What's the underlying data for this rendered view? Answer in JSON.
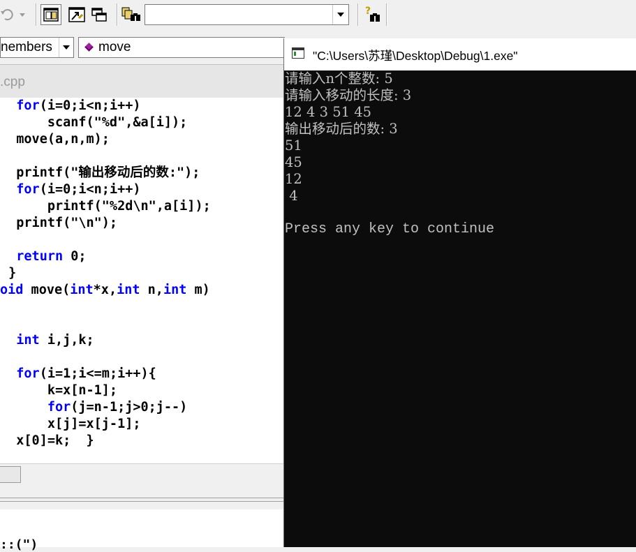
{
  "toolbar": {
    "find_value": "",
    "icons": [
      "undo-arrow-icon",
      "dropdown-icon",
      "workspace-icon",
      "output-icon",
      "window-list-icon",
      "find-in-files-icon",
      "find-icon"
    ]
  },
  "wizard": {
    "members_label": "nembers",
    "function_label": "move"
  },
  "editor": {
    "tab_name": ".cpp",
    "lines": [
      {
        "indent": "  ",
        "parts": [
          {
            "t": "for",
            "kw": true
          },
          {
            "t": "(i=0;i<n;i++)"
          }
        ]
      },
      {
        "indent": "      ",
        "parts": [
          {
            "t": "scanf(\"%d\",&a[i]);"
          }
        ]
      },
      {
        "indent": "  ",
        "parts": [
          {
            "t": "move(a,n,m);"
          }
        ]
      },
      {
        "indent": "",
        "parts": []
      },
      {
        "indent": "  ",
        "parts": [
          {
            "t": "printf(\"输出移动后的数:\");"
          }
        ]
      },
      {
        "indent": "  ",
        "parts": [
          {
            "t": "for",
            "kw": true
          },
          {
            "t": "(i=0;i<n;i++)"
          }
        ]
      },
      {
        "indent": "      ",
        "parts": [
          {
            "t": "printf(\"%2d\\n\",a[i]);"
          }
        ]
      },
      {
        "indent": "  ",
        "parts": [
          {
            "t": "printf(\"\\n\");"
          }
        ]
      },
      {
        "indent": "",
        "parts": []
      },
      {
        "indent": "  ",
        "parts": [
          {
            "t": "return",
            "kw": true
          },
          {
            "t": " 0;"
          }
        ]
      },
      {
        "indent": " ",
        "parts": [
          {
            "t": "}"
          }
        ]
      },
      {
        "indent": "",
        "parts": [
          {
            "t": "oid",
            "kw": true
          },
          {
            "t": " move("
          },
          {
            "t": "int",
            "kw": true
          },
          {
            "t": "*x,"
          },
          {
            "t": "int",
            "kw": true
          },
          {
            "t": " n,"
          },
          {
            "t": "int",
            "kw": true
          },
          {
            "t": " m)"
          }
        ]
      },
      {
        "indent": "",
        "parts": []
      },
      {
        "indent": "",
        "parts": []
      },
      {
        "indent": "  ",
        "parts": [
          {
            "t": "int",
            "kw": true
          },
          {
            "t": " i,j,k;"
          }
        ]
      },
      {
        "indent": "",
        "parts": []
      },
      {
        "indent": "  ",
        "parts": [
          {
            "t": "for",
            "kw": true
          },
          {
            "t": "(i=1;i<=m;i++){"
          }
        ]
      },
      {
        "indent": "      ",
        "parts": [
          {
            "t": "k=x[n-1];"
          }
        ]
      },
      {
        "indent": "      ",
        "parts": [
          {
            "t": "for",
            "kw": true
          },
          {
            "t": "(j=n-1;j>0;j--)"
          }
        ]
      },
      {
        "indent": "      ",
        "parts": [
          {
            "t": "x[j]=x[j-1];"
          }
        ]
      },
      {
        "indent": "  ",
        "parts": [
          {
            "t": "x[0]=k;  }"
          }
        ]
      }
    ],
    "output_fragment": "::(\")"
  },
  "console": {
    "title": "\"C:\\Users\\苏瑾\\Desktop\\Debug\\1.exe\"",
    "lines": [
      "请输入n个整数: 5",
      "请输入移动的长度: 3",
      "12 4 3 51 45",
      "输出移动后的数: 3",
      "51",
      "45",
      "12",
      " 4",
      "",
      "Press any key to continue"
    ]
  }
}
